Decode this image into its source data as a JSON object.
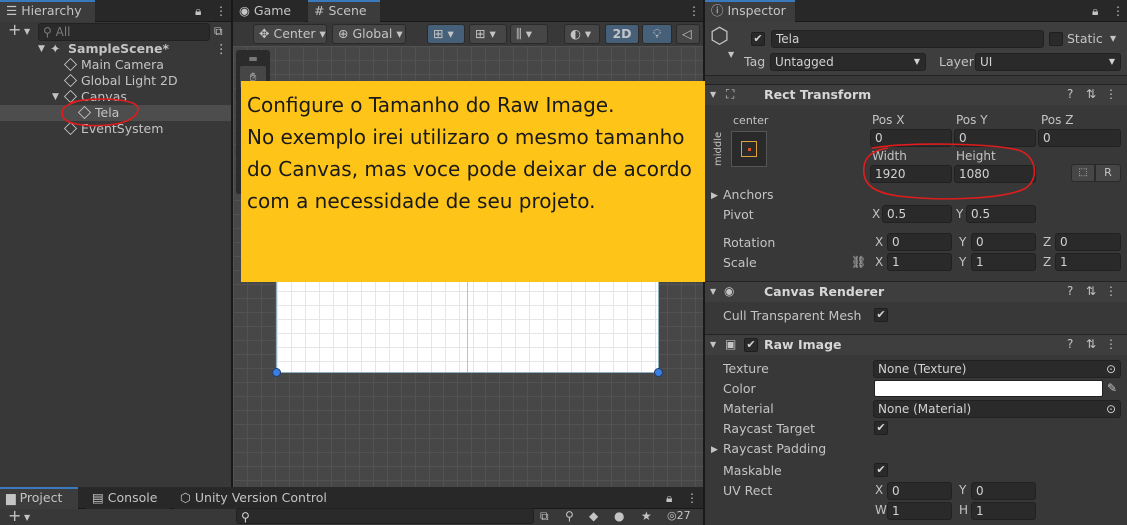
{
  "hierarchy": {
    "tab": "Hierarchy",
    "search_placeholder": "All",
    "items": [
      "SampleScene*",
      "Main Camera",
      "Global Light 2D",
      "Canvas",
      "Tela",
      "EventSystem"
    ]
  },
  "center_tabs": {
    "game": "Game",
    "scene": "Scene"
  },
  "scene_toolbar": {
    "pivot": "Center",
    "space": "Global",
    "mode_2d": "2D"
  },
  "overlay_text": "Configure o Tamanho do Raw Image.\nNo exemplo irei utilizaro o mesmo tamanho do Canvas, mas voce pode deixar de acordo com a necessidade de seu projeto.",
  "inspector": {
    "tab": "Inspector",
    "object_name": "Tela",
    "static_label": "Static",
    "tag_label": "Tag",
    "tag_value": "Untagged",
    "layer_label": "Layer",
    "layer_value": "UI",
    "rect_transform": {
      "title": "Rect Transform",
      "anchor_h": "center",
      "anchor_v": "middle",
      "pos_x_label": "Pos X",
      "pos_y_label": "Pos Y",
      "pos_z_label": "Pos Z",
      "pos_x": "0",
      "pos_y": "0",
      "pos_z": "0",
      "width_label": "Width",
      "height_label": "Height",
      "width": "1920",
      "height": "1080",
      "r_button": "R",
      "anchors_label": "Anchors",
      "pivot_label": "Pivot",
      "pivot_x": "0.5",
      "pivot_y": "0.5",
      "rotation_label": "Rotation",
      "rot_x": "0",
      "rot_y": "0",
      "rot_z": "0",
      "scale_label": "Scale",
      "scale_x": "1",
      "scale_y": "1",
      "scale_z": "1",
      "x": "X",
      "y": "Y",
      "z": "Z"
    },
    "canvas_renderer": {
      "title": "Canvas Renderer",
      "cull_label": "Cull Transparent Mesh"
    },
    "raw_image": {
      "title": "Raw Image",
      "texture_label": "Texture",
      "texture_value": "None (Texture)",
      "color_label": "Color",
      "material_label": "Material",
      "material_value": "None (Material)",
      "raycast_target_label": "Raycast Target",
      "raycast_padding_label": "Raycast Padding",
      "maskable_label": "Maskable",
      "uv_rect_label": "UV Rect",
      "uv_x": "0",
      "uv_y": "0",
      "uv_w": "1",
      "uv_h": "1",
      "w": "W",
      "h": "H"
    }
  },
  "bottom": {
    "project": "Project",
    "console": "Console",
    "vcs": "Unity Version Control",
    "count": "27"
  },
  "colors": {
    "accent": "#3a79bb",
    "overlay": "#fec418",
    "annotation": "#e01c1c"
  }
}
